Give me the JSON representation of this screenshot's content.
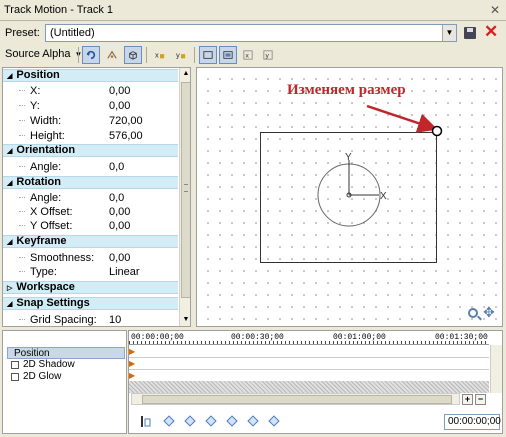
{
  "window": {
    "title": "Track Motion - Track 1",
    "close_glyph": "✕"
  },
  "preset": {
    "label": "Preset:",
    "value": "(Untitled)"
  },
  "toolbar": {
    "source_alpha_label": "Source Alpha"
  },
  "props": {
    "position": {
      "title": "Position",
      "x_label": "X:",
      "x_value": "0,00",
      "y_label": "Y:",
      "y_value": "0,00",
      "width_label": "Width:",
      "width_value": "720,00",
      "height_label": "Height:",
      "height_value": "576,00"
    },
    "orientation": {
      "title": "Orientation",
      "angle_label": "Angle:",
      "angle_value": "0,0"
    },
    "rotation": {
      "title": "Rotation",
      "angle_label": "Angle:",
      "angle_value": "0,0",
      "xoff_label": "X Offset:",
      "xoff_value": "0,00",
      "yoff_label": "Y Offset:",
      "yoff_value": "0,00"
    },
    "keyframe": {
      "title": "Keyframe",
      "smooth_label": "Smoothness:",
      "smooth_value": "0,00",
      "type_label": "Type:",
      "type_value": "Linear"
    },
    "workspace": {
      "title": "Workspace"
    },
    "snap": {
      "title": "Snap Settings",
      "grid_label": "Grid Spacing:",
      "grid_value": "10"
    }
  },
  "canvas": {
    "annotation": "Изменяем размер",
    "axis_y": "Y",
    "axis_x": "X"
  },
  "timeline": {
    "tracks": [
      "Position",
      "2D Shadow",
      "2D Glow"
    ],
    "ticks": [
      "00:00:00;00",
      "00:00:30;00",
      "00:01:00;00",
      "00:01:30;00"
    ],
    "time_value": "00:00:00;00"
  }
}
